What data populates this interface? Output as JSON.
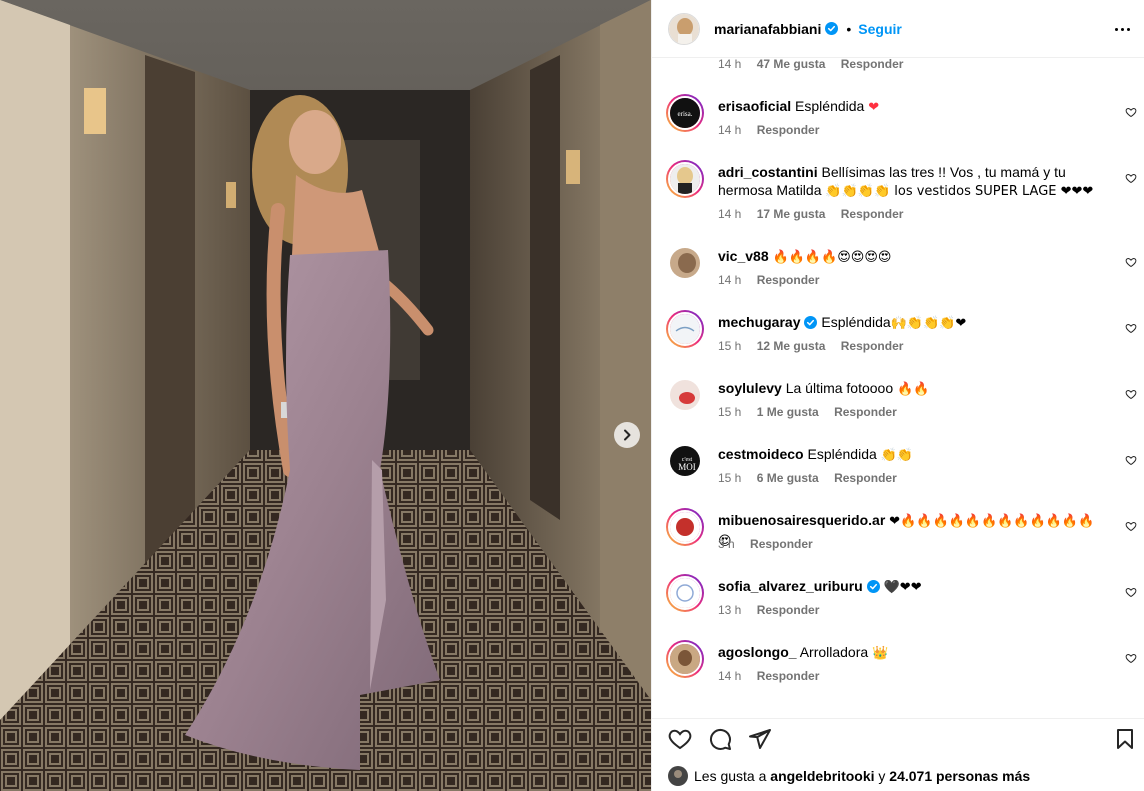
{
  "post": {
    "username": "marianafabbiani",
    "dot": "•",
    "follow_label": "Seguir",
    "more_icon": "more-horizontal-icon"
  },
  "top_meta": {
    "time": "14 h",
    "likes": "47 Me gusta",
    "reply": "Responder"
  },
  "comments": [
    {
      "user": "erisaoficial",
      "text": "Espléndida ",
      "emoji": "❤",
      "time": "14 h",
      "likes": "",
      "reply": "Responder"
    },
    {
      "user": "adri_costantini",
      "text": "Bellísimas las tres !! Vos , tu mamá y tu hermosa Matilda ",
      "emoji": "👏👏👏👏 los vestidos SUPER LAGE ❤❤❤",
      "time": "14 h",
      "likes": "17 Me gusta",
      "reply": "Responder"
    },
    {
      "user": "vic_v88",
      "text": "",
      "emoji": "🔥🔥🔥🔥😍😍😍😍",
      "time": "14 h",
      "likes": "",
      "reply": "Responder"
    },
    {
      "user": "mechugaray",
      "text": "Espléndida",
      "emoji": "🙌👏👏👏❤",
      "time": "15 h",
      "likes": "12 Me gusta",
      "reply": "Responder",
      "verified": true
    },
    {
      "user": "soylulevy",
      "text": "La última fotoooo ",
      "emoji": "🔥🔥",
      "time": "15 h",
      "likes": "1 Me gusta",
      "reply": "Responder"
    },
    {
      "user": "cestmoideco",
      "text": "Espléndida ",
      "emoji": "👏👏",
      "time": "15 h",
      "likes": "6 Me gusta",
      "reply": "Responder"
    },
    {
      "user": "mibuenosairesquerido.ar",
      "text": "",
      "emoji": "❤🔥🔥🔥🔥🔥🔥🔥🔥🔥🔥🔥🔥😍",
      "time": "3 h",
      "likes": "",
      "reply": "Responder"
    },
    {
      "user": "sofia_alvarez_uriburu",
      "text": "",
      "emoji": "🖤❤❤",
      "time": "13 h",
      "likes": "",
      "reply": "Responder",
      "verified": true
    },
    {
      "user": "agoslongo_",
      "text": "Arrolladora ",
      "emoji": "👑",
      "time": "14 h",
      "likes": "",
      "reply": "Responder"
    }
  ],
  "likes_line": {
    "prefix": "Les gusta a ",
    "user": "angeldebritooki",
    "middle": " y ",
    "count": "24.071 personas más"
  },
  "avatar_labels": {
    "erisa": "erisa.",
    "cest": "c'est",
    "moi": "MOI"
  },
  "colors": {
    "accent": "#0095f6",
    "heart": "#ff3040",
    "muted": "#737373"
  }
}
